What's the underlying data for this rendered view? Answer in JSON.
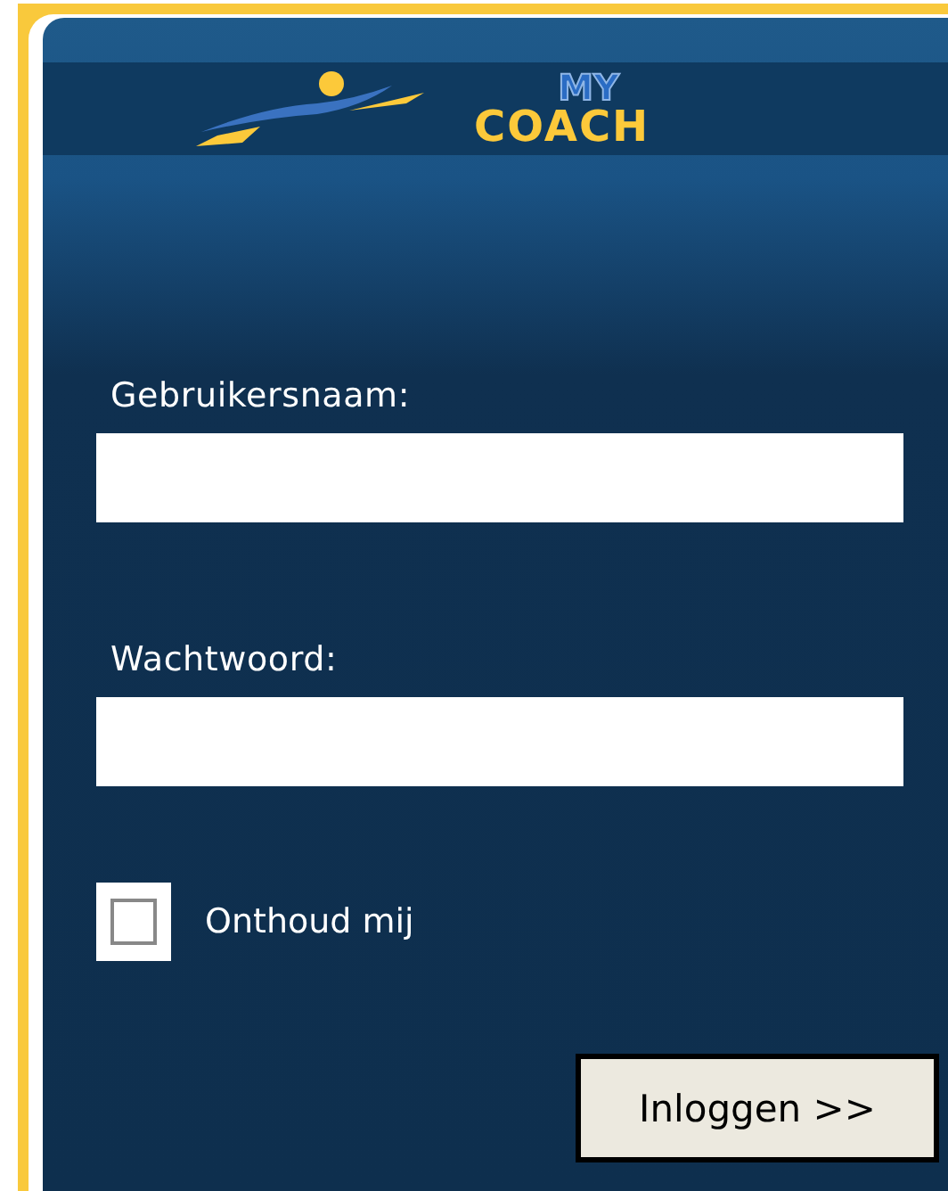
{
  "logo": {
    "line_1": "MY",
    "line_2": "COACH"
  },
  "fields": [
    {
      "label": "Gebruikersnaam:"
    },
    {
      "label": "Wachtwoord:"
    }
  ],
  "remember": {
    "label": "Onthoud mij",
    "checked": false
  },
  "button": {
    "label": "Inloggen >>"
  }
}
